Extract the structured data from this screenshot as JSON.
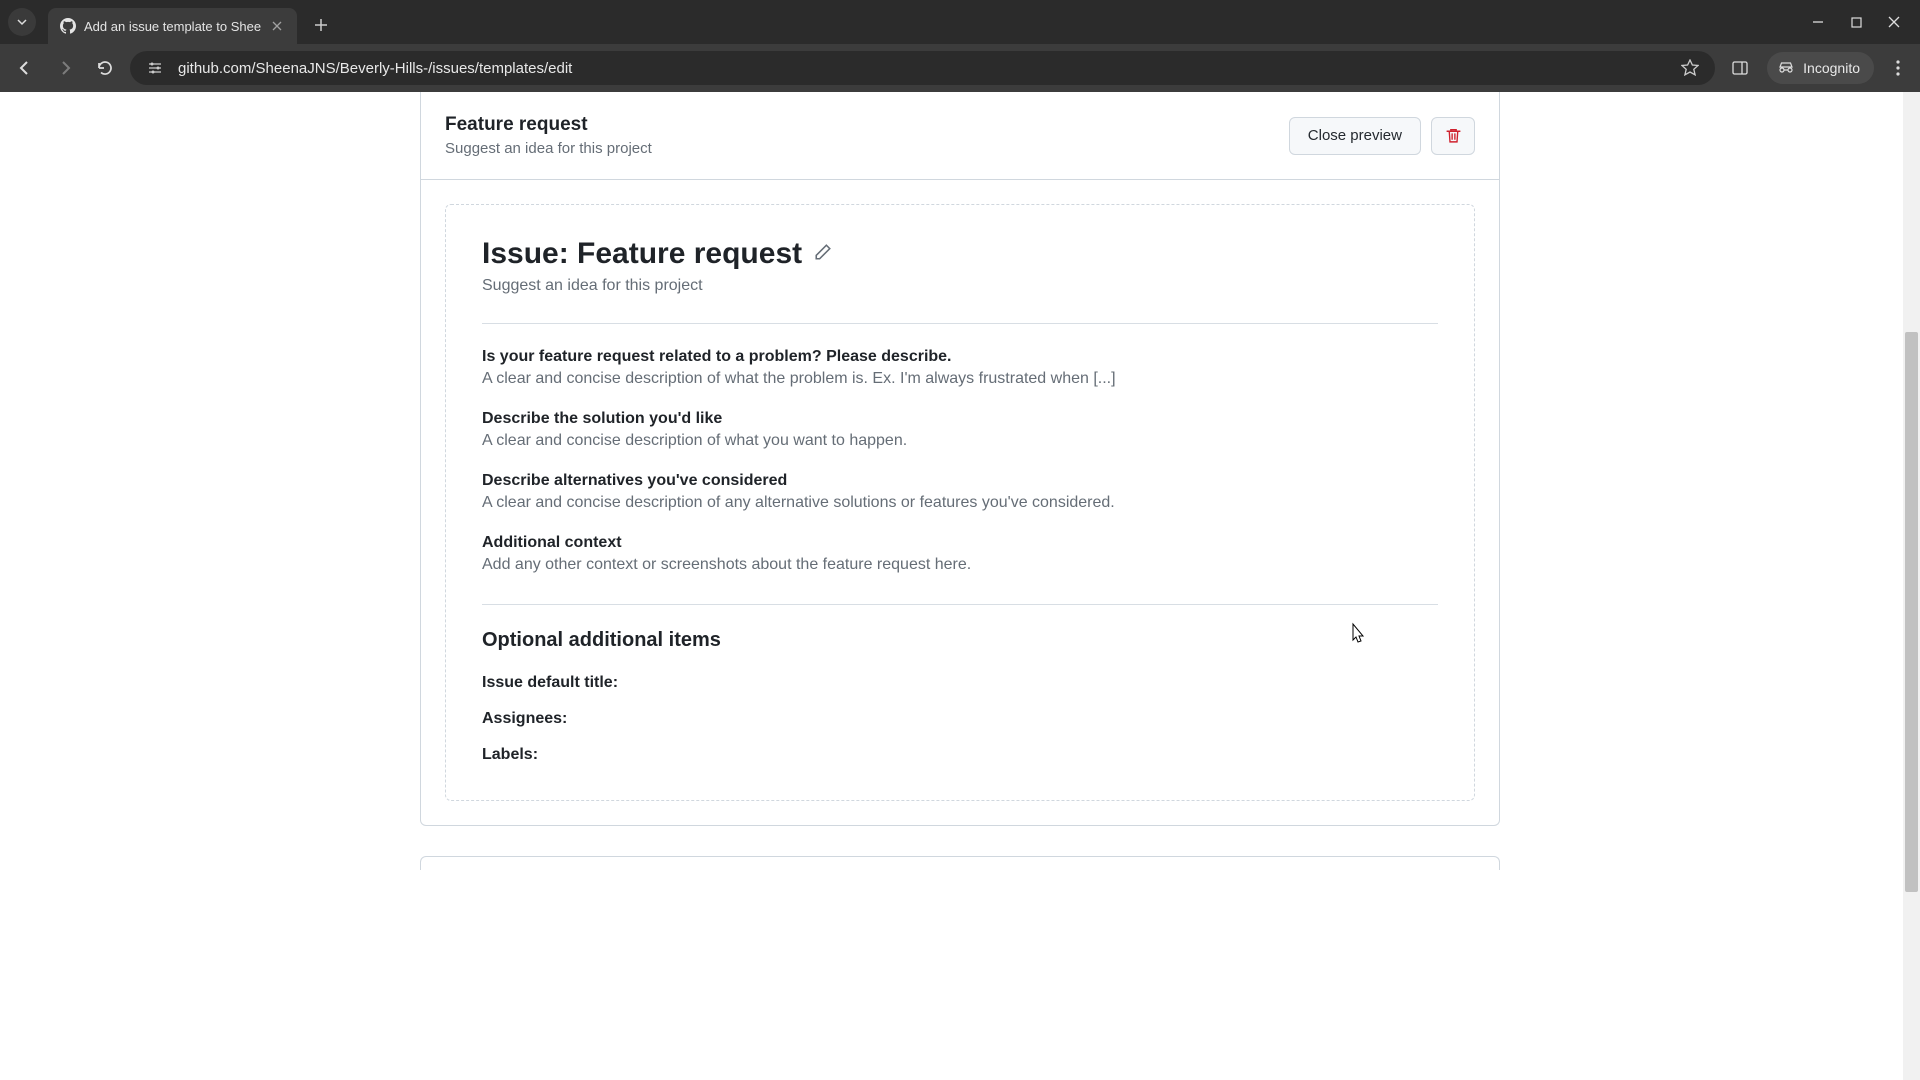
{
  "browser": {
    "tab_title": "Add an issue template to Shee",
    "url": "github.com/SheenaJNS/Beverly-Hills-/issues/templates/edit",
    "incognito_label": "Incognito"
  },
  "header": {
    "title": "Feature request",
    "subtitle": "Suggest an idea for this project",
    "close_preview_label": "Close preview"
  },
  "preview": {
    "issue_title": "Issue: Feature request",
    "issue_subtitle": "Suggest an idea for this project",
    "sections": [
      {
        "heading": "Is your feature request related to a problem? Please describe.",
        "desc": "A clear and concise description of what the problem is. Ex. I'm always frustrated when [...]"
      },
      {
        "heading": "Describe the solution you'd like",
        "desc": "A clear and concise description of what you want to happen."
      },
      {
        "heading": "Describe alternatives you've considered",
        "desc": "A clear and concise description of any alternative solutions or features you've considered."
      },
      {
        "heading": "Additional context",
        "desc": "Add any other context or screenshots about the feature request here."
      }
    ],
    "optional_heading": "Optional additional items",
    "meta": {
      "default_title_label": "Issue default title:",
      "assignees_label": "Assignees:",
      "labels_label": "Labels:"
    }
  }
}
